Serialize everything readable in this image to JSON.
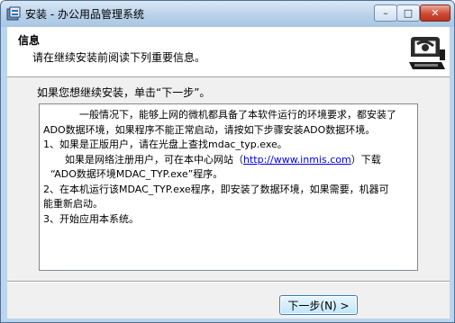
{
  "window": {
    "title": "安装 - 办公用品管理系统",
    "controls": {
      "minimize": "–",
      "maximize": "□",
      "close": "✕"
    }
  },
  "header": {
    "title": "信息",
    "subtitle": "请在继续安装前阅读下列重要信息。",
    "graphic": "install-computer-graphic"
  },
  "body": {
    "prompt": "如果您想继续安装，单击“下一步”。",
    "memo": {
      "line1": "一般情况下，能够上网的微机都具备了本软件运行的环境要求，都安装了",
      "line2": "ADO数据环境，如果程序不能正常启动，请按如下步骤安装ADO数据环境。",
      "line3": "1、如果是正版用户，请在光盘上查找mdac_typ.exe。",
      "line4_pre": "如果是网络注册用户，可在本中心网站（",
      "line4_link": "http://www.inmis.com",
      "line4_post": "）下载",
      "line5": "“ADO数据环境MDAC_TYP.exe”程序。",
      "line6": "2、在本机运行该MDAC_TYP.exe程序，即安装了数据环境，如果需要，机器可",
      "line7": "能重新启动。",
      "line8": "3、开始应用本系统。"
    }
  },
  "footer": {
    "next_label": "下一步(N) >"
  },
  "colors": {
    "titlebar": "#b9d1ea",
    "client": "#f0f0f0",
    "link": "#0000ee",
    "button_border": "#3c7fb1"
  }
}
